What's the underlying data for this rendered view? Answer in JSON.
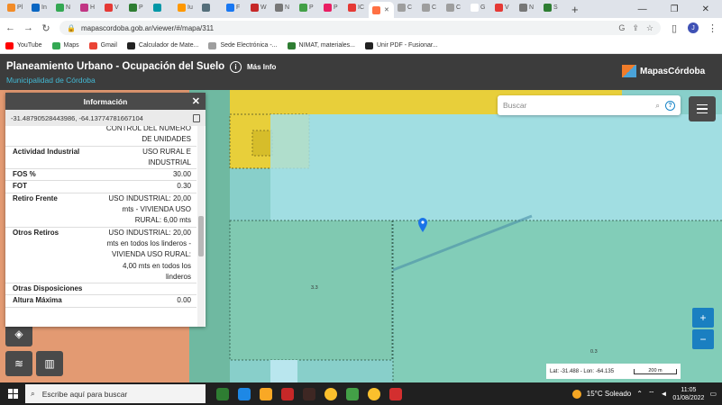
{
  "browser": {
    "tabs": [
      {
        "label": "Pl",
        "color": "#f28c28"
      },
      {
        "label": "In",
        "color": "#0a66c2"
      },
      {
        "label": "N",
        "color": "#34a853"
      },
      {
        "label": "H",
        "color": "#c13584"
      },
      {
        "label": "V",
        "color": "#e53935"
      },
      {
        "label": "P",
        "color": "#2e7d32"
      },
      {
        "label": "",
        "color": "#0097a7"
      },
      {
        "label": "Iu",
        "color": "#ff9800"
      },
      {
        "label": "",
        "color": "#546e7a"
      },
      {
        "label": "F",
        "color": "#1877f2"
      },
      {
        "label": "W",
        "color": "#c62828"
      },
      {
        "label": "N",
        "color": "#777777"
      },
      {
        "label": "P",
        "color": "#43a047"
      },
      {
        "label": "P",
        "color": "#e91e63"
      },
      {
        "label": "IC",
        "color": "#e53935"
      },
      {
        "label": "",
        "color": "#ff7043",
        "active": true
      },
      {
        "label": "C",
        "color": "#9e9e9e"
      },
      {
        "label": "C",
        "color": "#9e9e9e"
      },
      {
        "label": "C",
        "color": "#9e9e9e"
      },
      {
        "label": "G",
        "color": "#ffffff"
      },
      {
        "label": "V",
        "color": "#e53935"
      },
      {
        "label": "N",
        "color": "#777777"
      },
      {
        "label": "S",
        "color": "#2e7d32"
      }
    ],
    "url": "mapascordoba.gob.ar/viewer/#/mapa/311",
    "profile_initial": "J",
    "bookmarks": [
      {
        "label": "YouTube",
        "color": "#ff0000"
      },
      {
        "label": "Maps",
        "color": "#34a853"
      },
      {
        "label": "Gmail",
        "color": "#ea4335"
      },
      {
        "label": "Calculador de Mate...",
        "color": "#222222"
      },
      {
        "label": "Sede Electrónica -...",
        "color": "#9e9e9e"
      },
      {
        "label": "NIMAT, materiales...",
        "color": "#2e7d32"
      },
      {
        "label": "Unir PDF - Fusionar...",
        "color": "#222222"
      }
    ]
  },
  "header": {
    "title": "Planeamiento Urbano - Ocupación del Suelo",
    "subtitle": "Municipalidad de Córdoba",
    "info_label": "Más Info",
    "brand": "MapasCórdoba"
  },
  "map": {
    "search_placeholder": "Buscar",
    "labels": [
      "3.3",
      "0.3"
    ],
    "scale": {
      "lat_lon": "Lat: -31.488 - Lon: -64.135",
      "distance": "200 m"
    }
  },
  "info_panel": {
    "title": "Información",
    "coordinates": "-31.48790528443986, -64.13774781667104",
    "rows": [
      {
        "key": "",
        "value": "CONTROL DEL NÚMERO DE UNIDADES"
      },
      {
        "key": "Actividad Industrial",
        "value": "USO RURAL E INDUSTRIAL"
      },
      {
        "key": "FOS %",
        "value": "30.00"
      },
      {
        "key": "FOT",
        "value": "0.30"
      },
      {
        "key": "Retiro Frente",
        "value": "USO INDUSTRIAL: 20,00 mts - VIVIENDA USO RURAL: 6,00 mts"
      },
      {
        "key": "Otros Retiros",
        "value": "USO INDUSTRIAL: 20,00 mts en todos los linderos - VIVIENDA USO RURAL: 4,00 mts en todos los linderos"
      },
      {
        "key": "Otras Disposiciones",
        "value": ""
      },
      {
        "key": "Altura Máxima",
        "value": "0.00"
      }
    ]
  },
  "taskbar": {
    "search_placeholder": "Escribe aquí para buscar",
    "weather": "15°C  Soleado",
    "time": "11:05",
    "date": "01/08/2022"
  }
}
